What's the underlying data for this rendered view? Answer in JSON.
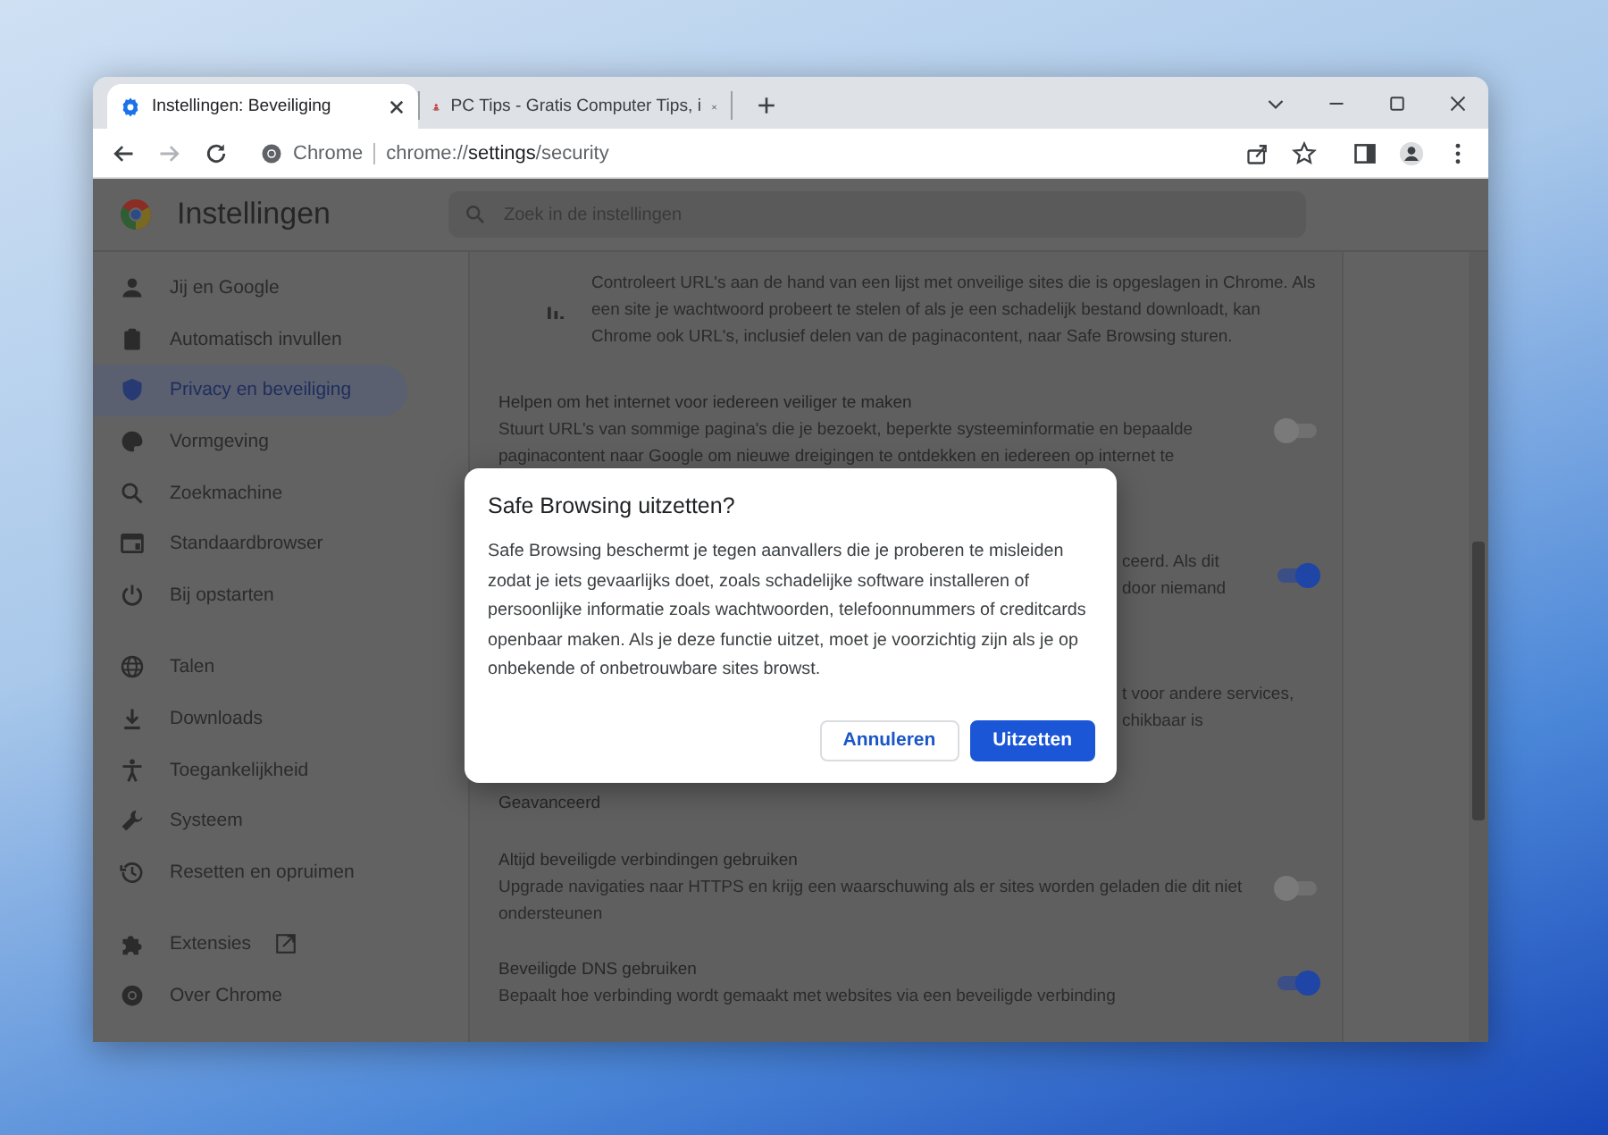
{
  "tabs": [
    {
      "title": "Instellingen: Beveiliging",
      "selected": true,
      "kind": "settings"
    },
    {
      "title": "PC Tips - Gratis Computer Tips, i",
      "selected": false,
      "kind": "site"
    }
  ],
  "new_tab": "+",
  "address": {
    "chip": "Chrome",
    "url": "chrome://**settings**/security"
  },
  "settings": {
    "title": "Instellingen",
    "search_placeholder": "Zoek in de instellingen"
  },
  "sidebar": [
    [
      {
        "label": "Jij en Google",
        "selected": false
      },
      {
        "label": "Automatisch invullen",
        "selected": false
      },
      {
        "label": "Privacy en beveiliging",
        "selected": true
      },
      {
        "label": "Vormgeving",
        "selected": false
      },
      {
        "label": "Zoekmachine",
        "selected": false
      },
      {
        "label": "Standaardbrowser",
        "selected": false
      },
      {
        "label": "Bij opstarten",
        "selected": false
      }
    ],
    [
      {
        "label": "Talen",
        "selected": false
      },
      {
        "label": "Downloads",
        "selected": false
      },
      {
        "label": "Toegankelijkheid",
        "selected": false
      },
      {
        "label": "Systeem",
        "selected": false
      },
      {
        "label": "Resetten en opruimen",
        "selected": false
      }
    ],
    [
      {
        "label": "Extensies",
        "selected": false,
        "external": true
      },
      {
        "label": "Over Chrome",
        "selected": false
      }
    ]
  ],
  "content": [
    {
      "kind": "info",
      "text": "Controleert URL's aan de hand van een lijst met onveilige sites die is opgeslagen in Chrome. Als een site je wachtwoord probeert te stelen of als je een schadelijk bestand downloadt, kan Chrome ook URL's, inclusief delen van de paginacontent, naar Safe Browsing sturen."
    },
    {
      "kind": "toggle",
      "title": "Helpen om het internet voor iedereen veiliger te maken",
      "lines": [
        "Stuurt URL's van sommige pagina's die je bezoekt, beperkte systeeminformatie en bepaalde",
        "paginacontent naar Google om nieuwe dreigingen te ontdekken en iedereen op internet te"
      ],
      "on": false
    },
    {
      "kind": "partial",
      "lines": [
        "ceerd. Als dit",
        "door niemand"
      ],
      "toggle": true,
      "on": true
    },
    {
      "kind": "partial",
      "lines": [
        "t voor andere services,",
        "chikbaar is"
      ],
      "toggle": false
    },
    {
      "kind": "heading",
      "title": "Geavanceerd"
    },
    {
      "kind": "toggle",
      "title": "Altijd beveiligde verbindingen gebruiken",
      "lines": [
        "Upgrade navigaties naar HTTPS en krijg een waarschuwing als er sites worden geladen die dit niet",
        "ondersteunen"
      ],
      "on": false
    },
    {
      "kind": "toggle",
      "title": "Beveiligde DNS gebruiken",
      "lines": [
        "Bepaalt hoe verbinding wordt gemaakt met websites via een beveiligde verbinding"
      ],
      "on": true
    }
  ],
  "dialog": {
    "title": "Safe Browsing uitzetten?",
    "body": "Safe Browsing beschermt je tegen aanvallers die je proberen te misleiden zodat je iets gevaarlijks doet, zoals schadelijke software installeren of persoonlijke informatie zoals wachtwoorden, telefoonnummers of creditcards openbaar maken. Als je deze functie uitzet, moet je voorzichtig zijn als je op onbekende of onbetrouwbare sites browst.",
    "buttons": [
      {
        "label": "Annuleren",
        "kind": "secondary"
      },
      {
        "label": "Uitzetten",
        "kind": "primary"
      }
    ]
  }
}
